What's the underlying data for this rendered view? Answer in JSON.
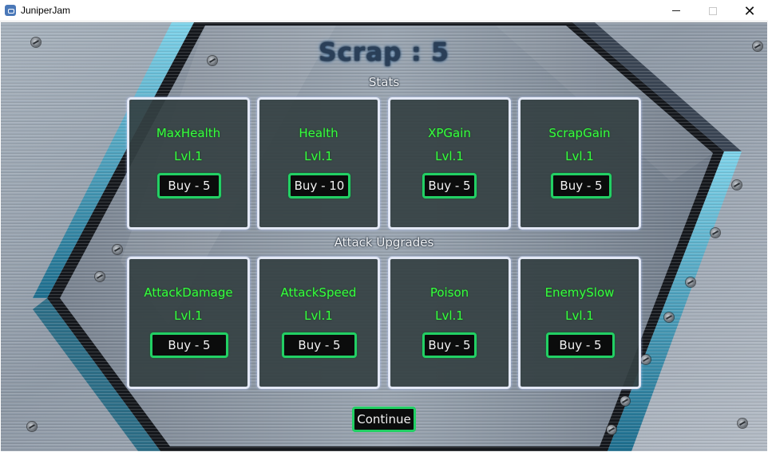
{
  "window": {
    "title": "JuniperJam",
    "minimize_glyph": "",
    "close_glyph": "✕"
  },
  "header": {
    "scrap_text": "Scrap : 5"
  },
  "sections": {
    "stats": "Stats",
    "attack": "Attack Upgrades"
  },
  "stats_cards": [
    {
      "name": "MaxHealth",
      "level": "Lvl.1",
      "buy": "Buy - 5"
    },
    {
      "name": "Health",
      "level": "Lvl.1",
      "buy": "Buy - 10"
    },
    {
      "name": "XPGain",
      "level": "Lvl.1",
      "buy": "Buy - 5"
    },
    {
      "name": "ScrapGain",
      "level": "Lvl.1",
      "buy": "Buy - 5"
    }
  ],
  "attack_cards": [
    {
      "name": "AttackDamage",
      "level": "Lvl.1",
      "buy": "Buy - 5"
    },
    {
      "name": "AttackSpeed",
      "level": "Lvl.1",
      "buy": "Buy - 5"
    },
    {
      "name": "Poison",
      "level": "Lvl.1",
      "buy": "Buy - 5"
    },
    {
      "name": "EnemySlow",
      "level": "Lvl.1",
      "buy": "Buy - 5"
    }
  ],
  "continue_label": "Continue",
  "colors": {
    "label_green": "#37ff3f",
    "button_border": "#22d064",
    "card_border": "#e3e8f5"
  }
}
